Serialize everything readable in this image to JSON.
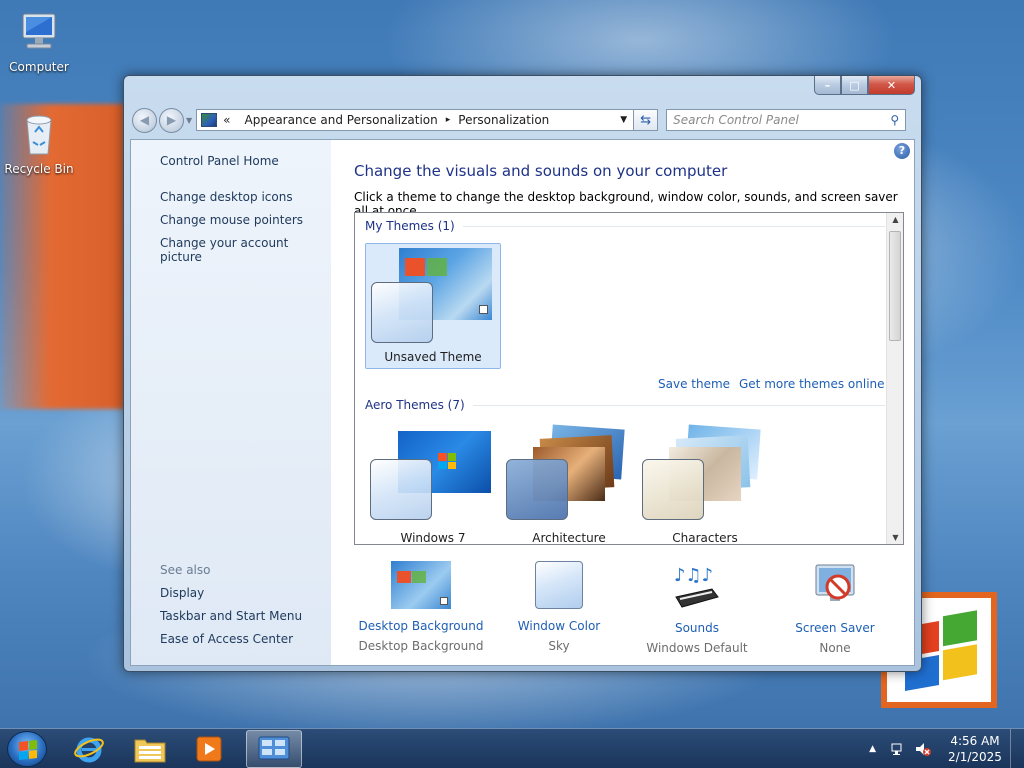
{
  "desktop": {
    "icons": [
      {
        "label": "Computer",
        "icon": "computer-icon"
      },
      {
        "label": "Recycle Bin",
        "icon": "recycle-bin-icon"
      }
    ]
  },
  "window": {
    "caption_buttons": {
      "minimize": "–",
      "maximize": "□",
      "close": "✕"
    },
    "breadcrumb": {
      "prefix": "«",
      "items": [
        "Appearance and Personalization",
        "Personalization"
      ],
      "separator": "▸"
    },
    "search": {
      "placeholder": "Search Control Panel"
    },
    "left_pane": {
      "home": "Control Panel Home",
      "links": [
        "Change desktop icons",
        "Change mouse pointers",
        "Change your account picture"
      ],
      "see_also_label": "See also",
      "see_also": [
        "Display",
        "Taskbar and Start Menu",
        "Ease of Access Center"
      ]
    },
    "main": {
      "title": "Change the visuals and sounds on your computer",
      "description": "Click a theme to change the desktop background, window color, sounds, and screen saver all at once.",
      "my_themes_header": "My Themes (1)",
      "my_themes": [
        {
          "label": "Unsaved Theme",
          "selected": true
        }
      ],
      "save_theme": "Save theme",
      "get_more": "Get more themes online",
      "aero_header": "Aero Themes (7)",
      "aero_themes": [
        {
          "label": "Windows 7"
        },
        {
          "label": "Architecture"
        },
        {
          "label": "Characters"
        }
      ]
    },
    "bottom": [
      {
        "title": "Desktop Background",
        "value": "Desktop Background",
        "icon": "desktop-background-icon"
      },
      {
        "title": "Window Color",
        "value": "Sky",
        "icon": "window-color-icon"
      },
      {
        "title": "Sounds",
        "value": "Windows Default",
        "icon": "sounds-icon"
      },
      {
        "title": "Screen Saver",
        "value": "None",
        "icon": "screen-saver-icon"
      }
    ]
  },
  "taskbar": {
    "pinned": [
      "internet-explorer-icon",
      "windows-explorer-icon",
      "media-player-icon",
      "control-panel-icon"
    ],
    "clock": {
      "time": "4:56 AM",
      "date": "2/1/2025"
    }
  },
  "colors": {
    "link": "#1e5fb5",
    "heading": "#1e3287",
    "accent": "#e2661f"
  }
}
